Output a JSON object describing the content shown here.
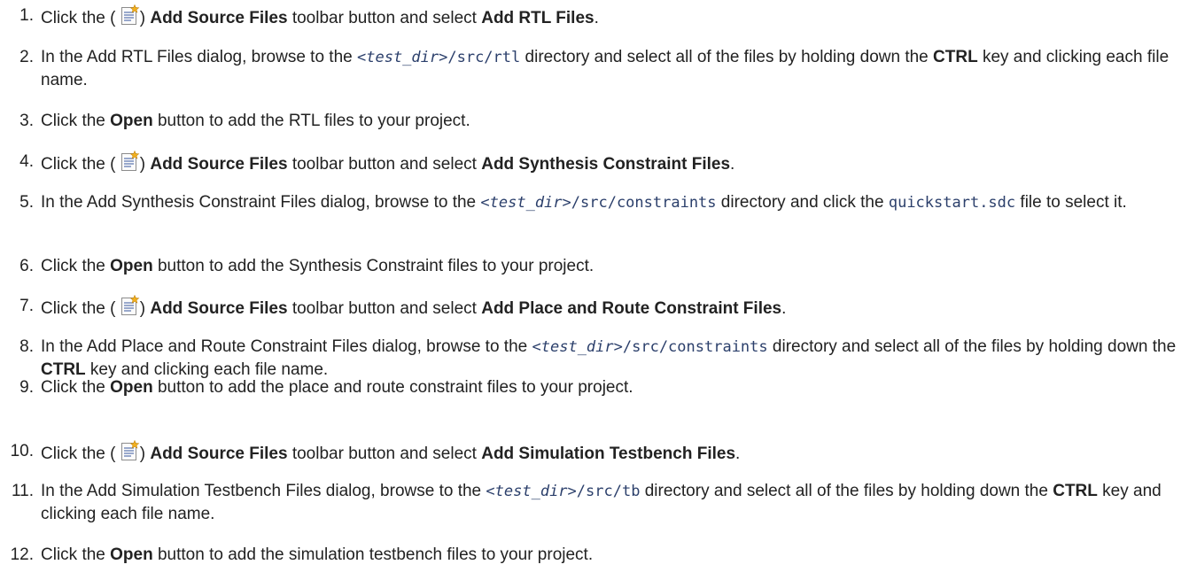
{
  "steps": [
    {
      "number": "1.",
      "parts": [
        {
          "t": "Click the ( "
        },
        {
          "icon": "add-source-files-icon"
        },
        {
          "t": ") "
        },
        {
          "b": "Add Source Files"
        },
        {
          "t": " toolbar button and select "
        },
        {
          "b": "Add RTL Files"
        },
        {
          "t": "."
        }
      ]
    },
    {
      "number": "2.",
      "parts": [
        {
          "t": "In the Add RTL Files dialog, browse to the "
        },
        {
          "c": "<"
        },
        {
          "ci": "test_dir"
        },
        {
          "c": ">/src/rtl"
        },
        {
          "t": " directory and select all of the files by holding down the "
        },
        {
          "b": "CTRL"
        },
        {
          "t": " key and clicking each file name."
        }
      ]
    },
    {
      "number": "3.",
      "parts": [
        {
          "t": "Click the "
        },
        {
          "b": "Open"
        },
        {
          "t": " button to add the RTL files to your project."
        }
      ]
    },
    {
      "number": "4.",
      "parts": [
        {
          "t": "Click the ( "
        },
        {
          "icon": "add-source-files-icon"
        },
        {
          "t": ") "
        },
        {
          "b": "Add Source Files"
        },
        {
          "t": " toolbar button and select "
        },
        {
          "b": "Add Synthesis Constraint Files"
        },
        {
          "t": "."
        }
      ]
    },
    {
      "number": "5.",
      "parts": [
        {
          "t": "In the Add Synthesis Constraint Files dialog, browse to the "
        },
        {
          "c": "<"
        },
        {
          "ci": "test_dir"
        },
        {
          "c": ">/src/constraints"
        },
        {
          "t": " directory and click the "
        },
        {
          "c": "quickstart.sdc"
        },
        {
          "t": " file to select it."
        }
      ]
    },
    {
      "number": "6.",
      "parts": [
        {
          "t": "Click the "
        },
        {
          "b": "Open"
        },
        {
          "t": " button to add the Synthesis Constraint files to your project."
        }
      ]
    },
    {
      "number": "7.",
      "parts": [
        {
          "t": "Click the ( "
        },
        {
          "icon": "add-source-files-icon"
        },
        {
          "t": ") "
        },
        {
          "b": "Add Source Files"
        },
        {
          "t": " toolbar button and select "
        },
        {
          "b": "Add Place and Route Constraint Files"
        },
        {
          "t": "."
        }
      ]
    },
    {
      "number": "8.",
      "parts": [
        {
          "t": "In the Add Place and Route Constraint Files dialog, browse to the "
        },
        {
          "c": "<"
        },
        {
          "ci": "test_dir"
        },
        {
          "c": ">/src/constraints"
        },
        {
          "t": " directory and select all of the files by holding down the "
        },
        {
          "b": "CTRL"
        },
        {
          "t": " key and clicking each file name."
        }
      ]
    },
    {
      "number": "9.",
      "parts": [
        {
          "t": "Click the "
        },
        {
          "b": "Open"
        },
        {
          "t": " button to add the place and route constraint files to your project."
        }
      ]
    },
    {
      "number": "10.",
      "parts": [
        {
          "t": "Click the ( "
        },
        {
          "icon": "add-source-files-icon"
        },
        {
          "t": ") "
        },
        {
          "b": "Add Source Files"
        },
        {
          "t": " toolbar button and select "
        },
        {
          "b": "Add Simulation Testbench Files"
        },
        {
          "t": "."
        }
      ]
    },
    {
      "number": "11.",
      "parts": [
        {
          "t": "In the Add Simulation Testbench Files dialog, browse to the "
        },
        {
          "c": "<"
        },
        {
          "ci": "test_dir"
        },
        {
          "c": ">/src/tb"
        },
        {
          "t": " directory and select all of the files by holding down the "
        },
        {
          "b": "CTRL"
        },
        {
          "t": " key and clicking each file name."
        }
      ]
    },
    {
      "number": "12.",
      "parts": [
        {
          "t": "Click the "
        },
        {
          "b": "Open"
        },
        {
          "t": " button to add the simulation testbench files to your project."
        }
      ]
    }
  ]
}
